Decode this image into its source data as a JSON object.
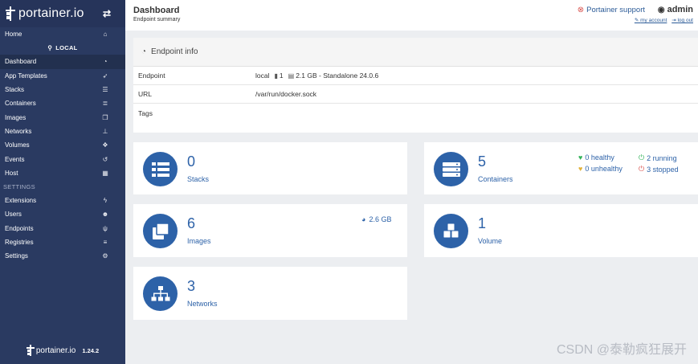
{
  "brand": {
    "name": "portainer.io",
    "toggle_icon": "exchange-icon"
  },
  "sidebar": {
    "home": {
      "label": "Home",
      "icon": "home-icon"
    },
    "endpoint_label": "LOCAL",
    "items": [
      {
        "label": "Dashboard",
        "icon": "tachometer-icon",
        "active": true
      },
      {
        "label": "App Templates",
        "icon": "rocket-icon"
      },
      {
        "label": "Stacks",
        "icon": "th-list-icon"
      },
      {
        "label": "Containers",
        "icon": "server-icon"
      },
      {
        "label": "Images",
        "icon": "clone-icon"
      },
      {
        "label": "Networks",
        "icon": "sitemap-icon"
      },
      {
        "label": "Volumes",
        "icon": "cubes-icon"
      },
      {
        "label": "Events",
        "icon": "history-icon"
      },
      {
        "label": "Host",
        "icon": "th-icon"
      }
    ],
    "settings_section": "SETTINGS",
    "settings_items": [
      {
        "label": "Extensions",
        "icon": "bolt-icon"
      },
      {
        "label": "Users",
        "icon": "users-icon"
      },
      {
        "label": "Endpoints",
        "icon": "plug-icon"
      },
      {
        "label": "Registries",
        "icon": "database-icon"
      },
      {
        "label": "Settings",
        "icon": "cogs-icon"
      }
    ],
    "footer": {
      "name": "portainer.io",
      "version": "1.24.2"
    }
  },
  "header": {
    "title": "Dashboard",
    "subtitle": "Endpoint summary",
    "support": "Portainer support",
    "user": "admin",
    "my_account": "my account",
    "log_out": "log out"
  },
  "endpoint_info": {
    "title": "Endpoint info",
    "rows": {
      "endpoint": {
        "key": "Endpoint",
        "name": "local",
        "cpu": "1",
        "memory": "2.1 GB - Standalone 24.0.6"
      },
      "url": {
        "key": "URL",
        "value": "/var/run/docker.sock"
      },
      "tags": {
        "key": "Tags",
        "value": ""
      }
    }
  },
  "cards": {
    "stacks": {
      "count": "0",
      "label": "Stacks"
    },
    "containers": {
      "count": "5",
      "label": "Containers",
      "healthy": "0 healthy",
      "running": "2 running",
      "unhealthy": "0 unhealthy",
      "stopped": "3 stopped"
    },
    "images": {
      "count": "6",
      "label": "Images",
      "size": "2.6 GB"
    },
    "volumes": {
      "count": "1",
      "label": "Volume"
    },
    "networks": {
      "count": "3",
      "label": "Networks"
    }
  },
  "colors": {
    "sidebar": "#2a3a61",
    "accent": "#2d62a8",
    "healthy": "#33b35a",
    "unhealthy": "#e2b23a",
    "stopped": "#d9534f"
  },
  "watermark": "CSDN @泰勒疯狂展开"
}
